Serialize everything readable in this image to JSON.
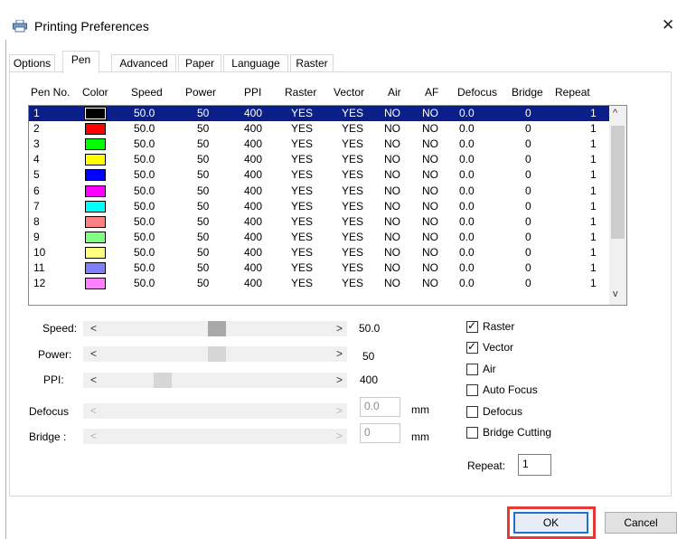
{
  "window": {
    "title": "Printing Preferences",
    "close_glyph": "✕",
    "icon": "printer-icon"
  },
  "tabs": [
    "Options",
    "Pen",
    "Advanced",
    "Paper",
    "Language",
    "Raster"
  ],
  "active_tab": "Pen",
  "table": {
    "headers": [
      "Pen No.",
      "Color",
      "Speed",
      "Power",
      "PPI",
      "Raster",
      "Vector",
      "Air",
      "AF",
      "Defocus",
      "Bridge",
      "Repeat"
    ],
    "rows": [
      {
        "pen": "1",
        "color": "#000000",
        "speed": "50.0",
        "power": "50",
        "ppi": "400",
        "raster": "YES",
        "vector": "YES",
        "air": "NO",
        "af": "NO",
        "defocus": "0.0",
        "bridge": "0",
        "repeat": "1"
      },
      {
        "pen": "2",
        "color": "#ff0000",
        "speed": "50.0",
        "power": "50",
        "ppi": "400",
        "raster": "YES",
        "vector": "YES",
        "air": "NO",
        "af": "NO",
        "defocus": "0.0",
        "bridge": "0",
        "repeat": "1"
      },
      {
        "pen": "3",
        "color": "#00ff00",
        "speed": "50.0",
        "power": "50",
        "ppi": "400",
        "raster": "YES",
        "vector": "YES",
        "air": "NO",
        "af": "NO",
        "defocus": "0.0",
        "bridge": "0",
        "repeat": "1"
      },
      {
        "pen": "4",
        "color": "#ffff00",
        "speed": "50.0",
        "power": "50",
        "ppi": "400",
        "raster": "YES",
        "vector": "YES",
        "air": "NO",
        "af": "NO",
        "defocus": "0.0",
        "bridge": "0",
        "repeat": "1"
      },
      {
        "pen": "5",
        "color": "#0000ff",
        "speed": "50.0",
        "power": "50",
        "ppi": "400",
        "raster": "YES",
        "vector": "YES",
        "air": "NO",
        "af": "NO",
        "defocus": "0.0",
        "bridge": "0",
        "repeat": "1"
      },
      {
        "pen": "6",
        "color": "#ff00ff",
        "speed": "50.0",
        "power": "50",
        "ppi": "400",
        "raster": "YES",
        "vector": "YES",
        "air": "NO",
        "af": "NO",
        "defocus": "0.0",
        "bridge": "0",
        "repeat": "1"
      },
      {
        "pen": "7",
        "color": "#00ffff",
        "speed": "50.0",
        "power": "50",
        "ppi": "400",
        "raster": "YES",
        "vector": "YES",
        "air": "NO",
        "af": "NO",
        "defocus": "0.0",
        "bridge": "0",
        "repeat": "1"
      },
      {
        "pen": "8",
        "color": "#ff8080",
        "speed": "50.0",
        "power": "50",
        "ppi": "400",
        "raster": "YES",
        "vector": "YES",
        "air": "NO",
        "af": "NO",
        "defocus": "0.0",
        "bridge": "0",
        "repeat": "1"
      },
      {
        "pen": "9",
        "color": "#80ff80",
        "speed": "50.0",
        "power": "50",
        "ppi": "400",
        "raster": "YES",
        "vector": "YES",
        "air": "NO",
        "af": "NO",
        "defocus": "0.0",
        "bridge": "0",
        "repeat": "1"
      },
      {
        "pen": "10",
        "color": "#ffff80",
        "speed": "50.0",
        "power": "50",
        "ppi": "400",
        "raster": "YES",
        "vector": "YES",
        "air": "NO",
        "af": "NO",
        "defocus": "0.0",
        "bridge": "0",
        "repeat": "1"
      },
      {
        "pen": "11",
        "color": "#8080ff",
        "speed": "50.0",
        "power": "50",
        "ppi": "400",
        "raster": "YES",
        "vector": "YES",
        "air": "NO",
        "af": "NO",
        "defocus": "0.0",
        "bridge": "0",
        "repeat": "1"
      },
      {
        "pen": "12",
        "color": "#ff80ff",
        "speed": "50.0",
        "power": "50",
        "ppi": "400",
        "raster": "YES",
        "vector": "YES",
        "air": "NO",
        "af": "NO",
        "defocus": "0.0",
        "bridge": "0",
        "repeat": "1"
      }
    ],
    "selected_row": 0
  },
  "scroll": {
    "up": "^",
    "down": "v"
  },
  "sliders": {
    "left_arrow": "<",
    "right_arrow": ">",
    "speed": {
      "label": "Speed:",
      "value": "50.0"
    },
    "power": {
      "label": "Power:",
      "value": "50"
    },
    "ppi": {
      "label": "PPI:",
      "value": "400"
    },
    "defocus": {
      "label": "Defocus",
      "value": "0.0",
      "unit": "mm"
    },
    "bridge": {
      "label": "Bridge :",
      "value": "0",
      "unit": "mm"
    }
  },
  "checkboxes": {
    "tick": "✓",
    "raster": {
      "label": "Raster",
      "checked": true
    },
    "vector": {
      "label": "Vector",
      "checked": true
    },
    "air": {
      "label": "Air",
      "checked": false
    },
    "auto_focus": {
      "label": "Auto Focus",
      "checked": false
    },
    "defocus": {
      "label": "Defocus",
      "checked": false
    },
    "bridge_cutting": {
      "label": "Bridge Cutting",
      "checked": false
    }
  },
  "repeat": {
    "label": "Repeat:",
    "value": "1"
  },
  "buttons": {
    "ok": "OK",
    "cancel": "Cancel"
  }
}
